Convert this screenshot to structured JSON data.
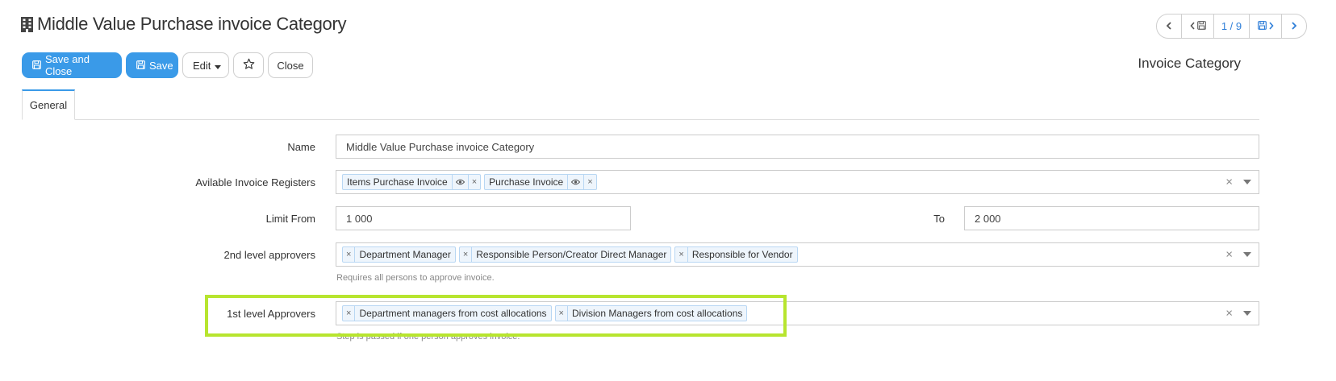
{
  "header": {
    "title": "Middle Value Purchase invoice Category",
    "title_icon": "building-icon",
    "form_type": "Invoice Category"
  },
  "pager": {
    "position": "1 / 9"
  },
  "toolbar": {
    "save_close_label": "Save and Close",
    "save_label": "Save",
    "edit_label": "Edit",
    "close_label": "Close"
  },
  "tabs": [
    {
      "label": "General",
      "active": true
    }
  ],
  "form": {
    "name": {
      "label": "Name",
      "value": "Middle Value Purchase invoice Category"
    },
    "registers": {
      "label": "Avilable Invoice Registers",
      "tags": [
        "Items Purchase Invoice",
        "Purchase Invoice"
      ]
    },
    "limit": {
      "from_label": "Limit From",
      "from_value": "1 000",
      "to_label": "To",
      "to_value": "2 000"
    },
    "second_level": {
      "label": "2nd level approvers",
      "tags": [
        "Department Manager",
        "Responsible Person/Creator Direct Manager",
        "Responsible for Vendor"
      ],
      "help": "Requires all persons to approve invoice."
    },
    "first_level": {
      "label": "1st level Approvers",
      "tags": [
        "Department managers from cost allocations",
        "Division Managers from cost allocations"
      ],
      "help": "Step is passed if one person approves invoice."
    }
  },
  "colors": {
    "primary": "#3a9ae8",
    "highlight": "#b7e52f",
    "pager_text": "#2e7ed8"
  }
}
